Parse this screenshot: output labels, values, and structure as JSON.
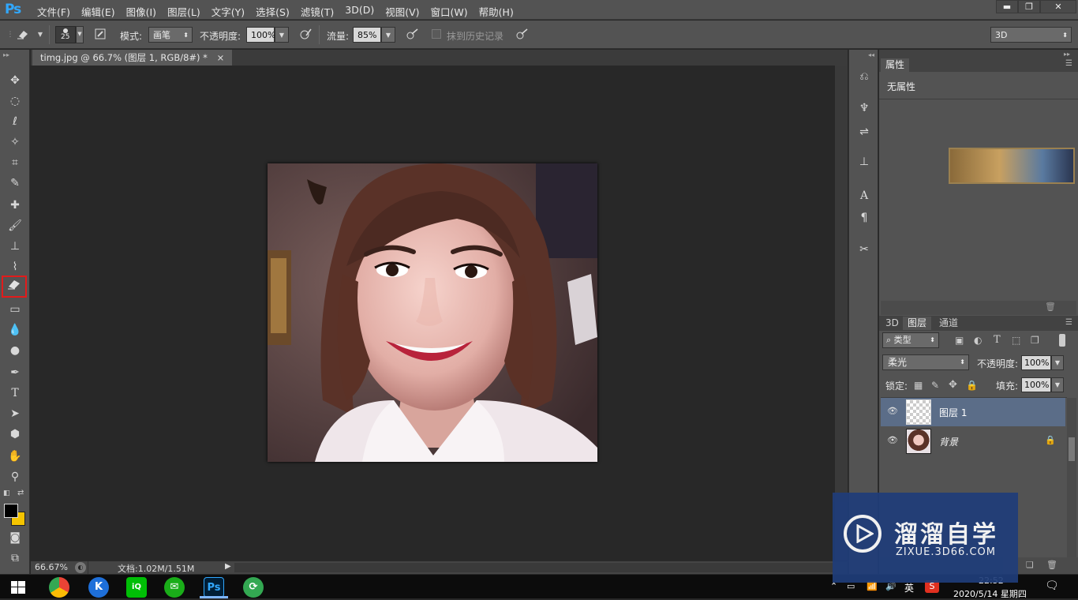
{
  "app": {
    "logo": "Ps"
  },
  "menu": [
    "文件(F)",
    "编辑(E)",
    "图像(I)",
    "图层(L)",
    "文字(Y)",
    "选择(S)",
    "滤镜(T)",
    "3D(D)",
    "视图(V)",
    "窗口(W)",
    "帮助(H)"
  ],
  "window_controls": {
    "minimize": "▬",
    "restore": "❐",
    "close": "✕"
  },
  "options": {
    "brush_size": "25",
    "mode_label": "模式:",
    "mode_value": "画笔",
    "opacity_label": "不透明度:",
    "opacity_value": "100%",
    "flow_label": "流量:",
    "flow_value": "85%",
    "erase_history_label": "抹到历史记录",
    "workspace_value": "3D"
  },
  "document": {
    "tab_title": "timg.jpg @ 66.7% (图层 1, RGB/8#) *",
    "close_glyph": "×"
  },
  "status": {
    "zoom": "66.67%",
    "doc_info": "文档:1.02M/1.51M"
  },
  "properties_panel": {
    "tab": "属性",
    "no_properties": "无属性"
  },
  "layers_panel": {
    "tabs": [
      "3D",
      "图层",
      "通道"
    ],
    "filter_kind": "类型",
    "blend_mode": "柔光",
    "opacity_label": "不透明度:",
    "opacity_value": "100%",
    "lock_label": "锁定:",
    "fill_label": "填充:",
    "fill_value": "100%",
    "layers": [
      {
        "name": "图层 1",
        "selected": true
      },
      {
        "name": "背景",
        "selected": false
      }
    ]
  },
  "taskbar": {
    "ime": "英",
    "time": "22:52",
    "date": "2020/5/14 星期四"
  },
  "watermark": {
    "brand_cn": "溜溜自学",
    "brand_url": "ZIXUE.3D66.COM"
  },
  "colors": {
    "panel_bg": "#535353",
    "canvas_bg": "#282828",
    "selection_highlight": "#e21b1b",
    "layer_selected": "#5b6d88",
    "watermark_bg": "#1f3d7a"
  }
}
